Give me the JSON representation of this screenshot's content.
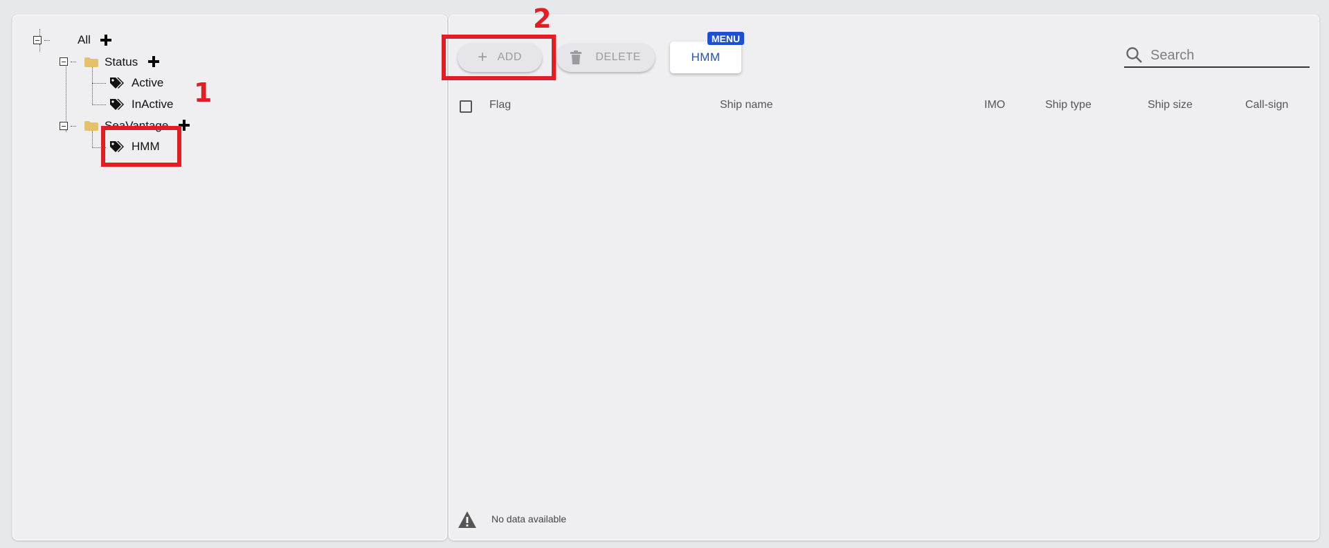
{
  "tree": {
    "root": {
      "label": "All"
    },
    "groups": [
      {
        "label": "Status",
        "children": [
          {
            "label": "Active"
          },
          {
            "label": "InActive"
          }
        ]
      },
      {
        "label": "SeaVantage",
        "children": [
          {
            "label": "HMM"
          }
        ]
      }
    ]
  },
  "annotations": {
    "step1": "1",
    "step2": "2"
  },
  "toolbar": {
    "add_label": "ADD",
    "delete_label": "DELETE",
    "hmm_label": "HMM",
    "menu_badge": "MENU"
  },
  "search": {
    "placeholder": "Search"
  },
  "table": {
    "columns": [
      "Flag",
      "Ship name",
      "IMO",
      "Ship type",
      "Ship size",
      "Call-sign"
    ],
    "empty_text": "No data available"
  },
  "colors": {
    "accent": "#1d50c4",
    "highlight": "#e41d23",
    "folder": "#e4c16a"
  }
}
